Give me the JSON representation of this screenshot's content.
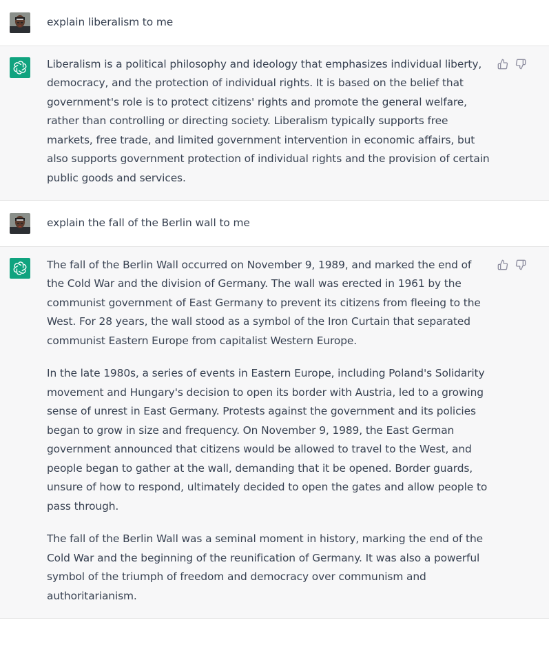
{
  "colors": {
    "user_bg": "#ffffff",
    "assistant_bg": "#f7f7f8",
    "assistant_avatar": "#10a37f",
    "text": "#374151",
    "icon": "#8e8ea0"
  },
  "icons": {
    "user_avatar": "user-avatar-photo",
    "assistant_avatar": "openai-logo-icon",
    "thumbs_up": "thumbs-up-icon",
    "thumbs_down": "thumbs-down-icon"
  },
  "conversation": [
    {
      "role": "user",
      "text": "explain liberalism to me"
    },
    {
      "role": "assistant",
      "paragraphs": [
        "Liberalism is a political philosophy and ideology that emphasizes individual liberty, democracy, and the protection of individual rights. It is based on the belief that government's role is to protect citizens' rights and promote the general welfare, rather than controlling or directing society. Liberalism typically supports free markets, free trade, and limited government intervention in economic affairs, but also supports government protection of individual rights and the provision of certain public goods and services."
      ]
    },
    {
      "role": "user",
      "text": "explain the fall of the Berlin wall to me"
    },
    {
      "role": "assistant",
      "paragraphs": [
        "The fall of the Berlin Wall occurred on November 9, 1989, and marked the end of the Cold War and the division of Germany. The wall was erected in 1961 by the communist government of East Germany to prevent its citizens from fleeing to the West. For 28 years, the wall stood as a symbol of the Iron Curtain that separated communist Eastern Europe from capitalist Western Europe.",
        "In the late 1980s, a series of events in Eastern Europe, including Poland's Solidarity movement and Hungary's decision to open its border with Austria, led to a growing sense of unrest in East Germany. Protests against the government and its policies began to grow in size and frequency. On November 9, 1989, the East German government announced that citizens would be allowed to travel to the West, and people began to gather at the wall, demanding that it be opened. Border guards, unsure of how to respond, ultimately decided to open the gates and allow people to pass through.",
        "The fall of the Berlin Wall was a seminal moment in history, marking the end of the Cold War and the beginning of the reunification of Germany. It was also a powerful symbol of the triumph of freedom and democracy over communism and authoritarianism."
      ]
    }
  ]
}
